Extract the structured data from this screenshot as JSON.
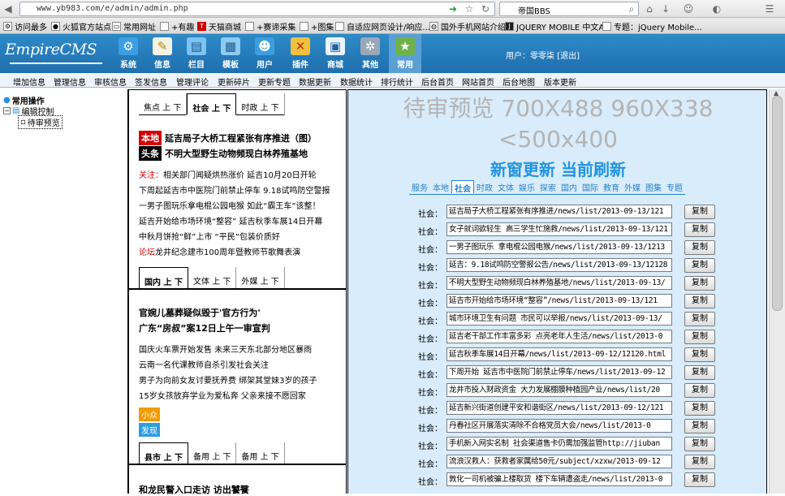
{
  "browser": {
    "url": "www.yb983.com/e/admin/admin.php",
    "search_text": "帝国BBS"
  },
  "bookmarks": [
    "访问最多",
    "火狐官方站点",
    "常用网址",
    "+有趣",
    "天猫商城",
    "+赛谛采集",
    "+图集",
    "自适应网页设计/响应...",
    "国外手机网站介绍",
    "JQUERY MOBILE 中文A...",
    "专题：jQuery Mobile..."
  ],
  "header": {
    "logo": "EmpireCMS",
    "user_label": "用户：",
    "user_name": "零零柒",
    "logout": "[退出]",
    "icons": [
      {
        "label": "系统",
        "icon": "gear-icon"
      },
      {
        "label": "信息",
        "icon": "document-icon"
      },
      {
        "label": "栏目",
        "icon": "folder-icon"
      },
      {
        "label": "模板",
        "icon": "template-icon"
      },
      {
        "label": "用户",
        "icon": "user-icon"
      },
      {
        "label": "插件",
        "icon": "plugin-icon"
      },
      {
        "label": "商城",
        "icon": "shop-icon"
      },
      {
        "label": "其他",
        "icon": "settings-icon"
      },
      {
        "label": "常用",
        "icon": "star-icon"
      }
    ]
  },
  "menu": [
    "增加信息",
    "管理信息",
    "审核信息",
    "签发信息",
    "管理评论",
    "更新碎片",
    "更新专题",
    "数据更新",
    "数据统计",
    "排行统计",
    "后台首页",
    "网站首页",
    "后台地图",
    "版本更新"
  ],
  "tree": {
    "root": "常用操作",
    "child": "编辑控制",
    "leaf": "待审预览"
  },
  "left": {
    "tabs1": [
      {
        "label": "焦点 上 下"
      },
      {
        "label": "社会 上 下"
      },
      {
        "label": "时政 上 下"
      }
    ],
    "headlines1": [
      {
        "tag": "本地",
        "text": "延吉局子大桥工程紧张有序推进（图）"
      },
      {
        "tag": "头条",
        "text": "不明大型野生动物频现白林养殖基地"
      }
    ],
    "news1": [
      {
        "red": "关注：",
        "text": "相关部门闻疑烘热涨价 延吉10月20日开轮"
      },
      {
        "red": "",
        "text": "下周起延吉市中医院门前禁止停车 9.18试鸣防空警报"
      },
      {
        "red": "",
        "text": "一男子图玩乐拿电棍公园电猴 如此“霸王车”该整！"
      },
      {
        "red": "",
        "text": "延吉开始给市场环境“整容” 延吉秋季车展14日开幕"
      },
      {
        "red": "",
        "text": "中秋月饼抢“鲜”上市 “平民”包装价质好"
      },
      {
        "red": "论坛",
        "text": "龙井纪念建市100周年暨教师节歌舞表演"
      }
    ],
    "tabs2": [
      {
        "label": "国内 上 下"
      },
      {
        "label": "文体 上 下"
      },
      {
        "label": "外媒 上 下"
      }
    ],
    "headlines2": [
      "官婉儿墓葬疑似毁于'官方行为'",
      "广东“房叔”案12日上午一审宣判"
    ],
    "news2": [
      "国庆火车票开始发售 未来三天东北部分地区暴雨",
      "云南一名代课教师自杀引发社会关注",
      "男子为向前女友讨要抚养费 绑架其堂妹3岁的孩子",
      "15岁女孩放弃学业为爱私奔 父亲来接不愿回家"
    ],
    "tags3": [
      "小众",
      "发现"
    ],
    "tabs3": [
      {
        "label": "县市 上 下"
      },
      {
        "label": "备用 上 下"
      },
      {
        "label": "备用 上 下"
      }
    ],
    "headline3": "和龙民警入口走访 访出饕餮"
  },
  "right": {
    "title_line1": "待审预览 700X488 960X338",
    "title_line2": "<500x400",
    "refresh": "新窗更新 当前刷新",
    "tabs": [
      "服务",
      "本地",
      "社会",
      "时政",
      "文体",
      "娱乐",
      "探索",
      "国内",
      "国际",
      "教育",
      "外媒",
      "图集",
      "专题"
    ],
    "active_tab": "社会",
    "row_label": "社会：",
    "copy_label": "复制",
    "rows": [
      "延吉局子大桥工程紧张有序推进/news/list/2013-09-13/121",
      "女子就词欲轻生 高三学生忙施救/news/list/2013-09-13/121",
      "一男子图玩乐 拿电棍公园电猴/news/list/2013-09-13/1213",
      "延吉：9.18试鸣防空警报公告/news/list/2013-09-13/12128",
      "不明大型野生动物频现白林养殖基地/news/list/2013-09-13/",
      "延吉市开始给市场环境“整容”/news/list/2013-09-13/121",
      "城市环境卫生有问题 市民可以举报/news/list/2013-09-13/",
      "延吉老干部工作丰富多彩 点亮老年人生活/news/list/2013-0",
      "延吉秋季车展14日开幕/news/list/2013-09-12/12120.html",
      "下周开始 延吉市中医院门前禁止停车/news/list/2013-09-12",
      "龙井市投入财政资金 大力发展棚膜种植园产业/news/list/20",
      "延吉新兴街道创建平安和谐街区/news/list/2013-09-12/121",
      "丹春社区开展落实清除不合格党员大会/news/list/2013-0",
      "手机新入网实名制 社会渠道售卡仍需加强监管http://jiuban",
      "流浪汉救人：获救者家属给50元/subject/xzxw/2013-09-12",
      "敦化一司机被骗上楼取货 楼下车辆遭盗走/news/list/2013-0"
    ]
  }
}
